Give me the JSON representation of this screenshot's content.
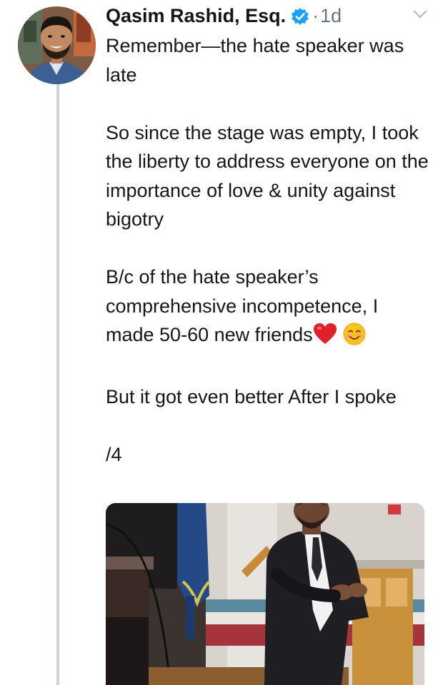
{
  "tweet": {
    "author": {
      "display_name": "Qasim Rashid, Esq.",
      "verified_icon": "verified-badge-icon",
      "avatar": "profile-photo"
    },
    "separator": "·",
    "time": "1d",
    "menu_icon": "chevron-down-icon",
    "paragraphs": [
      "Remember—the hate speaker was late",
      "So since the stage was empty, I took the liberty to address everyone on the importance of love & unity against bigotry",
      "B/c of the hate speaker’s comprehensive incompetence, I made 50-60 new friends",
      "But it got even better After I spoke",
      "/4"
    ],
    "paragraph3_emojis": [
      "red-heart-emoji",
      "smiling-face-emoji"
    ],
    "media": "photo-man-speaking-on-stage"
  },
  "colors": {
    "text": "#14171a",
    "secondary_text": "#657786",
    "verified_blue": "#1da1f2",
    "thread_line": "#c9d4dc"
  }
}
